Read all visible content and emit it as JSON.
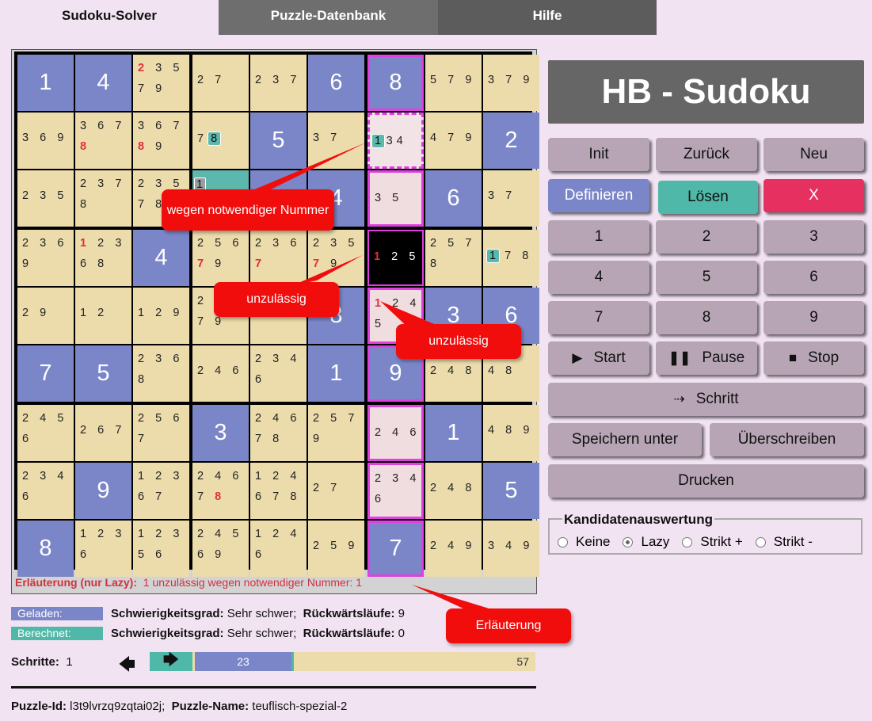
{
  "tabs": [
    "Sudoku-Solver",
    "Puzzle-Datenbank",
    "Hilfe"
  ],
  "board": {
    "cells": [
      [
        {
          "g": "1"
        },
        {
          "g": "4"
        },
        {
          "c1": [
            [
              "2",
              "r"
            ],
            "3",
            "5"
          ],
          "c2": [
            "7",
            "9"
          ]
        },
        {
          "cm": [
            "2",
            "7"
          ]
        },
        {
          "cm": [
            "2",
            "3",
            "7"
          ]
        },
        {
          "g": "6"
        },
        {
          "g": "8",
          "pink": true
        },
        {
          "cm": [
            "5",
            "7",
            "9"
          ]
        },
        {
          "cm": [
            "3",
            "7",
            "9"
          ]
        }
      ],
      [
        {
          "cm": [
            "3",
            "6",
            "9"
          ]
        },
        {
          "c1": [
            "3",
            "6",
            "7"
          ],
          "c2": [
            [
              "8",
              "r"
            ]
          ]
        },
        {
          "c1": [
            "3",
            "6",
            "7"
          ],
          "c2": [
            [
              "8",
              "r"
            ],
            "9"
          ]
        },
        {
          "special": "78"
        },
        {
          "g": "5"
        },
        {
          "cm": [
            "3",
            "7"
          ]
        },
        {
          "special": "134"
        },
        {
          "cm": [
            "4",
            "7",
            "9"
          ]
        },
        {
          "g": "2"
        }
      ],
      [
        {
          "cm": [
            "2",
            "3",
            "5"
          ]
        },
        {
          "c1": [
            "2",
            "3",
            "7"
          ],
          "c2": [
            "8"
          ]
        },
        {
          "c1": [
            "2",
            "3",
            "5"
          ],
          "c2": [
            "7",
            "8"
          ]
        },
        {
          "special": "g1"
        },
        {
          "g": "9"
        },
        {
          "g": "4"
        },
        {
          "cm": [
            "3",
            "5"
          ],
          "pinkbox": true
        },
        {
          "g": "6"
        },
        {
          "cm": [
            "3",
            "7"
          ]
        }
      ],
      [
        {
          "c1": [
            "2",
            "3",
            "6"
          ],
          "c2": [
            "9"
          ]
        },
        {
          "c1": [
            [
              "1",
              "r"
            ],
            "2",
            "3"
          ],
          "c2": [
            "6",
            "8"
          ]
        },
        {
          "g": "4"
        },
        {
          "c1": [
            "2",
            "5",
            "6"
          ],
          "c2": [
            [
              "7",
              "r"
            ],
            "9"
          ]
        },
        {
          "c1": [
            "2",
            "3",
            "6"
          ],
          "c2": [
            [
              "7",
              "r"
            ]
          ]
        },
        {
          "c1": [
            "2",
            "3",
            "5"
          ],
          "c2": [
            [
              "7",
              "r"
            ],
            "9"
          ]
        },
        {
          "special": "125"
        },
        {
          "c1": [
            "2",
            "5",
            "7"
          ],
          "c2": [
            "8"
          ]
        },
        {
          "special": "178"
        }
      ],
      [
        {
          "cm": [
            "2",
            "9"
          ]
        },
        {
          "cm": [
            "1",
            "2"
          ]
        },
        {
          "cm": [
            "1",
            "2",
            "9"
          ]
        },
        {
          "c1": [
            "2"
          ],
          "c2": [
            "7",
            "9"
          ]
        },
        {
          "cm": []
        },
        {
          "g": "8"
        },
        {
          "special": "1245"
        },
        {
          "g": "3"
        },
        {
          "g": "6"
        }
      ],
      [
        {
          "g": "7"
        },
        {
          "g": "5"
        },
        {
          "c1": [
            "2",
            "3",
            "6"
          ],
          "c2": [
            "8"
          ]
        },
        {
          "cm": [
            "2",
            "4",
            "6"
          ]
        },
        {
          "c1": [
            "2",
            "3",
            "4"
          ],
          "c2": [
            "6"
          ]
        },
        {
          "g": "1"
        },
        {
          "g": "9",
          "pink": true
        },
        {
          "cm": [
            "2",
            "4",
            "8"
          ]
        },
        {
          "cm": [
            "4",
            "8"
          ]
        }
      ],
      [
        {
          "c1": [
            "2",
            "4",
            "5"
          ],
          "c2": [
            "6"
          ]
        },
        {
          "cm": [
            "2",
            "6",
            "7"
          ]
        },
        {
          "c1": [
            "2",
            "5",
            "6"
          ],
          "c2": [
            "7"
          ]
        },
        {
          "g": "3"
        },
        {
          "c1": [
            "2",
            "4",
            "6"
          ],
          "c2": [
            "7",
            "8"
          ]
        },
        {
          "c1": [
            "2",
            "5",
            "7"
          ],
          "c2": [
            "9"
          ]
        },
        {
          "cm": [
            "2",
            "4",
            "6"
          ],
          "pinkbox": true
        },
        {
          "g": "1"
        },
        {
          "cm": [
            "4",
            "8",
            "9"
          ]
        }
      ],
      [
        {
          "c1": [
            "2",
            "3",
            "4"
          ],
          "c2": [
            "6"
          ]
        },
        {
          "g": "9"
        },
        {
          "c1": [
            "1",
            "2",
            "3"
          ],
          "c2": [
            "6",
            "7"
          ]
        },
        {
          "c1": [
            "2",
            "4",
            "6"
          ],
          "c2": [
            "7",
            [
              "8",
              "r"
            ]
          ]
        },
        {
          "c1": [
            "1",
            "2",
            "4"
          ],
          "c2": [
            "6",
            "7",
            "8"
          ]
        },
        {
          "cm": [
            "2",
            "7"
          ]
        },
        {
          "c1": [
            "2",
            "3",
            "4"
          ],
          "c2": [
            "6"
          ],
          "pinkbox": true
        },
        {
          "cm": [
            "2",
            "4",
            "8"
          ]
        },
        {
          "g": "5"
        }
      ],
      [
        {
          "g": "8"
        },
        {
          "c1": [
            "1",
            "2",
            "3"
          ],
          "c2": [
            "6"
          ]
        },
        {
          "c1": [
            "1",
            "2",
            "3"
          ],
          "c2": [
            "5",
            "6"
          ]
        },
        {
          "c1": [
            "2",
            "4",
            "5"
          ],
          "c2": [
            "6",
            "9"
          ]
        },
        {
          "c1": [
            "1",
            "2",
            "4"
          ],
          "c2": [
            "6"
          ]
        },
        {
          "cm": [
            "2",
            "5",
            "9"
          ]
        },
        {
          "g": "7",
          "pink": true
        },
        {
          "cm": [
            "2",
            "4",
            "9"
          ]
        },
        {
          "cm": [
            "3",
            "4",
            "9"
          ]
        }
      ]
    ],
    "explanation_label": "Erläuterung (nur Lazy):",
    "explanation_text": "1 unzulässig wegen notwendiger Nummer: 1"
  },
  "callouts": {
    "wegen": "wegen notwendiger Nummer",
    "unzulaessig1": "unzulässig",
    "unzulaessig2": "unzulässig",
    "erlaeuterung": "Erläuterung"
  },
  "panel": {
    "title": "HB - Sudoku",
    "init": "Init",
    "zurueck": "Zurück",
    "neu": "Neu",
    "definieren": "Definieren",
    "loesen": "Lösen",
    "x": "X",
    "numbers": [
      "1",
      "2",
      "3",
      "4",
      "5",
      "6",
      "7",
      "8",
      "9"
    ],
    "start": "Start",
    "pause": "Pause",
    "stop": "Stop",
    "schritt": "Schritt",
    "speichern": "Speichern unter",
    "ueberschreiben": "Überschreiben",
    "drucken": "Drucken",
    "kand_title": "Kandidatenauswertung",
    "kand_options": [
      "Keine",
      "Lazy",
      "Strikt +",
      "Strikt -"
    ],
    "kand_selected": "Lazy"
  },
  "info": {
    "geladen_tag": "Geladen:",
    "berechnet_tag": "Berechnet:",
    "schwierig_label": "Schwierigkeitsgrad:",
    "schwierig_value1": "Sehr schwer;",
    "schwierig_value2": "Sehr schwer;",
    "rueck_label": "Rückwärtsläufe:",
    "rueck_value1": "9",
    "rueck_value2": "0",
    "schritte_label": "Schritte:",
    "schritte_value": "1",
    "progress_value": "23",
    "progress_total": "57",
    "puzzle_id_label": "Puzzle-Id:",
    "puzzle_id": "l3t9lvrzq9zqtai02j;",
    "puzzle_name_label": "Puzzle-Name:",
    "puzzle_name": "teuflisch-spezial-2"
  },
  "colors": {
    "given": "#7b86c8",
    "candidate_bg": "#ecdcac",
    "highlight": "#e040e0",
    "teal": "#4fb8a8",
    "red": "#e0303a",
    "callout": "#f20d0d"
  }
}
